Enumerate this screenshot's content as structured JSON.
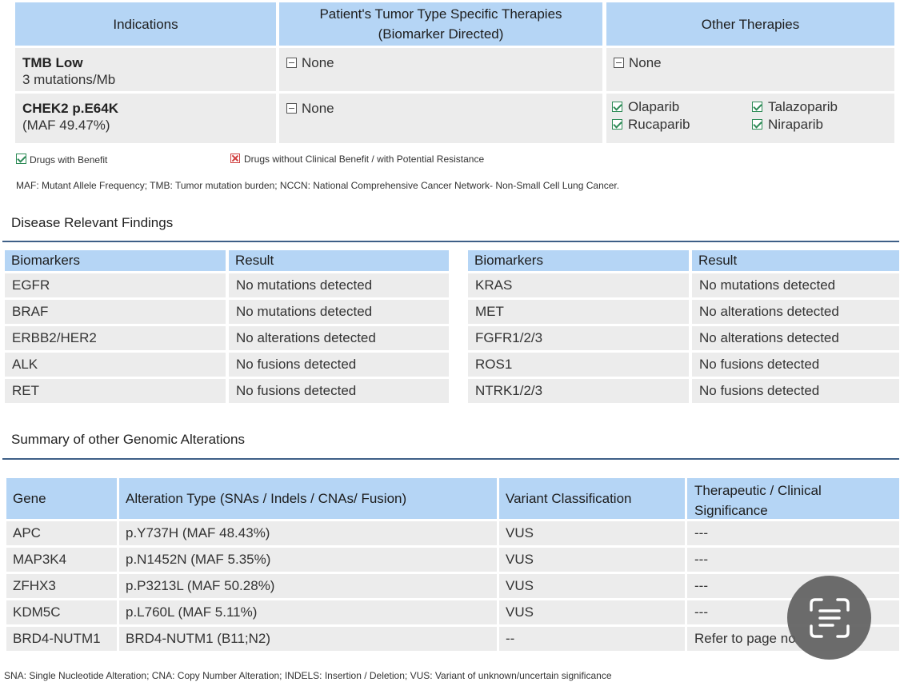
{
  "indications_table": {
    "headers": {
      "indications": "Indications",
      "tumor_line1": "Patient's Tumor Type Specific Therapies",
      "tumor_line2": "(Biomarker Directed)",
      "other": "Other Therapies"
    },
    "rows": [
      {
        "name": "TMB Low",
        "detail": "3 mutations/Mb",
        "tumor": "None",
        "other": "None"
      },
      {
        "name": "CHEK2 p.E64K",
        "detail": "(MAF 49.47%)",
        "tumor": "None",
        "other_drugs": [
          "Olaparib",
          "Talazoparib",
          "Rucaparib",
          "Niraparib"
        ]
      }
    ]
  },
  "legend": {
    "benefit": "Drugs with Benefit",
    "no_benefit": "Drugs without Clinical Benefit / with Potential Resistance"
  },
  "abbreviations_note": "MAF: Mutant Allele Frequency; TMB: Tumor mutation burden; NCCN: National Comprehensive Cancer Network- Non-Small Cell Lung Cancer.",
  "disease_findings": {
    "title": "Disease Relevant Findings",
    "col_biomarkers": "Biomarkers",
    "col_result": "Result",
    "left": [
      {
        "biomarker": "EGFR",
        "result": "No mutations detected"
      },
      {
        "biomarker": "BRAF",
        "result": "No mutations detected"
      },
      {
        "biomarker": "ERBB2/HER2",
        "result": "No alterations detected"
      },
      {
        "biomarker": "ALK",
        "result": "No fusions detected"
      },
      {
        "biomarker": "RET",
        "result": "No fusions detected"
      }
    ],
    "right": [
      {
        "biomarker": "KRAS",
        "result": "No mutations detected"
      },
      {
        "biomarker": "MET",
        "result": "No alterations detected"
      },
      {
        "biomarker": "FGFR1/2/3",
        "result": "No alterations detected"
      },
      {
        "biomarker": "ROS1",
        "result": "No fusions detected"
      },
      {
        "biomarker": "NTRK1/2/3",
        "result": "No fusions detected"
      }
    ]
  },
  "genomic_alterations": {
    "title": "Summary of other Genomic Alterations",
    "headers": {
      "gene": "Gene",
      "alteration": "Alteration Type (SNAs / Indels / CNAs/ Fusion)",
      "classification": "Variant Classification",
      "significance_line1": "Therapeutic / Clinical",
      "significance_line2": "Significance"
    },
    "rows": [
      {
        "gene": "APC",
        "alteration": "p.Y737H (MAF 48.43%)",
        "classification": "VUS",
        "significance": "---"
      },
      {
        "gene": "MAP3K4",
        "alteration": "p.N1452N (MAF 5.35%)",
        "classification": "VUS",
        "significance": "---"
      },
      {
        "gene": "ZFHX3",
        "alteration": "p.P3213L (MAF 50.28%)",
        "classification": "VUS",
        "significance": "---"
      },
      {
        "gene": "KDM5C",
        "alteration": "p.L760L (MAF 5.11%)",
        "classification": "VUS",
        "significance": "---"
      },
      {
        "gene": "BRD4-NUTM1",
        "alteration": "BRD4-NUTM1 (B11;N2)",
        "classification": "--",
        "significance": "Refer to page no"
      }
    ]
  },
  "footer_note": "SNA: Single Nucleotide Alteration; CNA: Copy Number Alteration; INDELS: Insertion / Deletion; VUS: Variant of unknown/uncertain significance",
  "colors": {
    "header_blue": "#b5d5f5",
    "row_gray": "#ececec",
    "rule_blue": "#3e5f87",
    "check_green": "#2e8b57",
    "x_red": "#d04040"
  },
  "overlay": {
    "icon": "text-scan-icon"
  }
}
